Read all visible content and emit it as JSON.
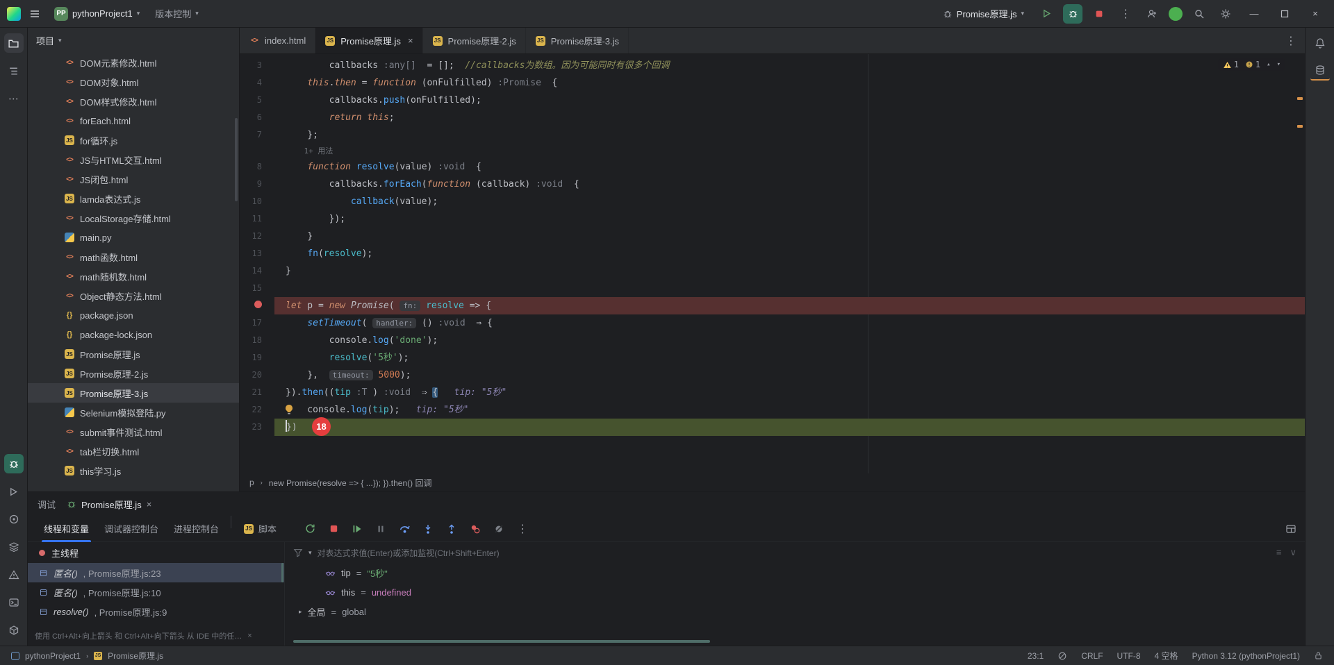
{
  "glyphs": {
    "chevron_down": "▾",
    "chevron_right": "▸",
    "close": "×",
    "more_v": "⋮",
    "more_h": "⋯",
    "minimize": "—",
    "crumb_sep": "›"
  },
  "titlebar": {
    "project_badge": "PP",
    "project_name": "pythonProject1",
    "vcs_label": "版本控制",
    "run_config": "Promise原理.js"
  },
  "icons": {
    "titlebar": [
      "pycharm-logo",
      "main-menu-icon",
      "run-config-icon",
      "run-icon",
      "debug-icon",
      "stop-icon",
      "more-actions-icon",
      "code-with-me-icon",
      "user-avatar",
      "search-icon",
      "settings-gear-icon",
      "minimize-icon",
      "maximize-icon",
      "close-icon"
    ],
    "left_strip": [
      "project-folder-icon",
      "structure-icon",
      "more-tools-icon",
      "debug-tool-icon",
      "run-tool-icon",
      "python-console-icon",
      "services-icon",
      "problems-icon",
      "terminal-icon",
      "python-packages-icon"
    ],
    "right_strip": [
      "notifications-icon",
      "database-icon"
    ]
  },
  "project_panel": {
    "header": "项目",
    "files": [
      {
        "name": "DOM元素修改.html",
        "type": "html"
      },
      {
        "name": "DOM对象.html",
        "type": "html"
      },
      {
        "name": "DOM样式修改.html",
        "type": "html"
      },
      {
        "name": "forEach.html",
        "type": "html"
      },
      {
        "name": "for循环.js",
        "type": "js"
      },
      {
        "name": "JS与HTML交互.html",
        "type": "html"
      },
      {
        "name": "JS闭包.html",
        "type": "html"
      },
      {
        "name": "lamda表达式.js",
        "type": "js"
      },
      {
        "name": "LocalStorage存储.html",
        "type": "html"
      },
      {
        "name": "main.py",
        "type": "py"
      },
      {
        "name": "math函数.html",
        "type": "html"
      },
      {
        "name": "math随机数.html",
        "type": "html"
      },
      {
        "name": "Object静态方法.html",
        "type": "html"
      },
      {
        "name": "package.json",
        "type": "json"
      },
      {
        "name": "package-lock.json",
        "type": "json"
      },
      {
        "name": "Promise原理.js",
        "type": "js"
      },
      {
        "name": "Promise原理-2.js",
        "type": "js"
      },
      {
        "name": "Promise原理-3.js",
        "type": "js",
        "selected": true
      },
      {
        "name": "Selenium模拟登陆.py",
        "type": "py"
      },
      {
        "name": "submit事件测试.html",
        "type": "html"
      },
      {
        "name": "tab栏切换.html",
        "type": "html"
      },
      {
        "name": "this学习.js",
        "type": "js"
      }
    ]
  },
  "editor": {
    "tabs": [
      {
        "label": "index.html",
        "type": "html",
        "active": false
      },
      {
        "label": "Promise原理.js",
        "type": "js",
        "active": true
      },
      {
        "label": "Promise原理-2.js",
        "type": "js",
        "active": false
      },
      {
        "label": "Promise原理-3.js",
        "type": "js",
        "active": false
      }
    ],
    "inspections": {
      "warnings": "1",
      "weak_warnings": "1"
    },
    "breadcrumbs": [
      "p",
      "new Promise(resolve => { ...}); }).then() 回调"
    ],
    "code": {
      "lines": [
        {
          "n": 3,
          "seg": [
            [
              "pl",
              "        callbacks "
            ],
            [
              "in",
              ":any[]"
            ],
            [
              "pl",
              "  = [];  "
            ],
            [
              "cm",
              "//callbacks为数组。因为可能同时有很多个回调"
            ]
          ]
        },
        {
          "n": 4,
          "seg": [
            [
              "pl",
              "    "
            ],
            [
              "kw",
              "this"
            ],
            [
              "pl",
              "."
            ],
            [
              "kw",
              "then"
            ],
            [
              "pl",
              " = "
            ],
            [
              "kw",
              "function"
            ],
            [
              "pl",
              " (onFulfilled) "
            ],
            [
              "in",
              ":Promise"
            ],
            [
              "pl",
              "  {"
            ]
          ]
        },
        {
          "n": 5,
          "seg": [
            [
              "pl",
              "        callbacks."
            ],
            [
              "fn",
              "push"
            ],
            [
              "pl",
              "(onFulfilled);"
            ]
          ]
        },
        {
          "n": 6,
          "seg": [
            [
              "pl",
              "        "
            ],
            [
              "kw",
              "return"
            ],
            [
              "pl",
              " "
            ],
            [
              "kw",
              "this"
            ],
            [
              "pl",
              ";"
            ]
          ]
        },
        {
          "n": 7,
          "seg": [
            [
              "pl",
              "    };"
            ]
          ]
        },
        {
          "inlay": "1+ 用法",
          "indent": "    "
        },
        {
          "n": 8,
          "seg": [
            [
              "pl",
              "    "
            ],
            [
              "kw",
              "function"
            ],
            [
              "pl",
              " "
            ],
            [
              "fn",
              "resolve"
            ],
            [
              "pl",
              "(value) "
            ],
            [
              "in",
              ":void"
            ],
            [
              "pl",
              "  {"
            ]
          ]
        },
        {
          "n": 9,
          "seg": [
            [
              "pl",
              "        callbacks."
            ],
            [
              "fn",
              "forEach"
            ],
            [
              "pl",
              "("
            ],
            [
              "kw",
              "function"
            ],
            [
              "pl",
              " (callback) "
            ],
            [
              "in",
              ":void"
            ],
            [
              "pl",
              "  {"
            ]
          ]
        },
        {
          "n": 10,
          "seg": [
            [
              "pl",
              "            "
            ],
            [
              "fn",
              "callback"
            ],
            [
              "pl",
              "(value);"
            ]
          ]
        },
        {
          "n": 11,
          "seg": [
            [
              "pl",
              "        });"
            ]
          ]
        },
        {
          "n": 12,
          "seg": [
            [
              "pl",
              "    }"
            ]
          ]
        },
        {
          "n": 13,
          "seg": [
            [
              "pl",
              "    "
            ],
            [
              "fn",
              "fn"
            ],
            [
              "pl",
              "("
            ],
            [
              "pa",
              "resolve"
            ],
            [
              "pl",
              ");"
            ]
          ]
        },
        {
          "n": 14,
          "seg": [
            [
              "pl",
              "}"
            ]
          ]
        },
        {
          "n": 15,
          "seg": []
        },
        {
          "n": 16,
          "bp": true,
          "seg": [
            [
              "kw",
              "let"
            ],
            [
              "pl",
              " p = "
            ],
            [
              "kw",
              "new"
            ],
            [
              "pl",
              " "
            ],
            [
              "cl",
              "Promise"
            ],
            [
              "pl",
              "( "
            ],
            [
              "ip",
              "fn:"
            ],
            [
              "pl",
              " "
            ],
            [
              "pa",
              "resolve"
            ],
            [
              "pl",
              " => {"
            ]
          ]
        },
        {
          "n": 17,
          "seg": [
            [
              "pl",
              "    "
            ],
            [
              "fni",
              "setTimeout"
            ],
            [
              "pl",
              "( "
            ],
            [
              "ip",
              "handler:"
            ],
            [
              "pl",
              " () "
            ],
            [
              "in",
              ":void"
            ],
            [
              "pl",
              "  ⇒ {"
            ]
          ]
        },
        {
          "n": 18,
          "seg": [
            [
              "pl",
              "        console."
            ],
            [
              "fn",
              "log"
            ],
            [
              "pl",
              "("
            ],
            [
              "st",
              "'done'"
            ],
            [
              "pl",
              ");"
            ]
          ]
        },
        {
          "n": 19,
          "seg": [
            [
              "pl",
              "        "
            ],
            [
              "pa",
              "resolve"
            ],
            [
              "pl",
              "("
            ],
            [
              "st",
              "'5秒'"
            ],
            [
              "pl",
              ");"
            ]
          ]
        },
        {
          "n": 20,
          "seg": [
            [
              "pl",
              "    },  "
            ],
            [
              "ip",
              "timeout:"
            ],
            [
              "pl",
              " "
            ],
            [
              "nu",
              "5000"
            ],
            [
              "pl",
              ");"
            ]
          ]
        },
        {
          "n": 21,
          "seg": [
            [
              "pl",
              "})."
            ],
            [
              "fn",
              "then"
            ],
            [
              "pl",
              "(("
            ],
            [
              "pa",
              "tip"
            ],
            [
              "pl",
              " "
            ],
            [
              "in",
              ":T"
            ],
            [
              "pl",
              " ) "
            ],
            [
              "in",
              ":void"
            ],
            [
              "pl",
              "  ⇒ "
            ],
            [
              "bh",
              "{"
            ],
            [
              "db",
              "   tip: \"5秒\""
            ]
          ]
        },
        {
          "n": 22,
          "bulb": true,
          "seg": [
            [
              "pl",
              "    console."
            ],
            [
              "fn",
              "log"
            ],
            [
              "pl",
              "("
            ],
            [
              "pa",
              "tip"
            ],
            [
              "pl",
              ");"
            ],
            [
              "db",
              "   tip: \"5秒\""
            ]
          ]
        },
        {
          "n": 23,
          "exec": true,
          "caret": true,
          "badge": "18",
          "seg": [
            [
              "pl",
              "})"
            ]
          ]
        }
      ]
    }
  },
  "debug": {
    "header": {
      "label": "调试",
      "session_tab": "Promise原理.js"
    },
    "view_tabs": [
      {
        "label": "线程和变量",
        "active": true
      },
      {
        "label": "调试器控制台",
        "active": false
      },
      {
        "label": "进程控制台",
        "active": false
      },
      {
        "label": "脚本",
        "active": false,
        "icon": "js"
      }
    ],
    "threads": {
      "thread_label": "主线程",
      "frames": [
        {
          "fn": "匿名()",
          "loc": "Promise原理.js:23",
          "selected": true
        },
        {
          "fn": "匿名()",
          "loc": "Promise原理.js:10",
          "selected": false
        },
        {
          "fn": "resolve()",
          "loc": "Promise原理.js:9",
          "selected": false
        }
      ],
      "hint": "使用 Ctrl+Alt+向上箭头 和 Ctrl+Alt+向下箭头 从 IDE 中的任…"
    },
    "variables": {
      "placeholder": "对表达式求值(Enter)或添加监视(Ctrl+Shift+Enter)",
      "items": [
        {
          "name": "tip",
          "eq": "=",
          "value": "\"5秒\"",
          "vtype": "str",
          "expandable": false
        },
        {
          "name": "this",
          "eq": "=",
          "value": "undefined",
          "vtype": "kw",
          "expandable": false
        },
        {
          "name": "全局",
          "eq": "=",
          "value": "global",
          "vtype": "plain",
          "expandable": true
        }
      ]
    }
  },
  "status_bar": {
    "project": "pythonProject1",
    "file": "Promise原理.js",
    "cursor": "23:1",
    "line_ending": "CRLF",
    "encoding": "UTF-8",
    "indent": "4 空格",
    "interpreter": "Python 3.12 (pythonProject1)"
  }
}
